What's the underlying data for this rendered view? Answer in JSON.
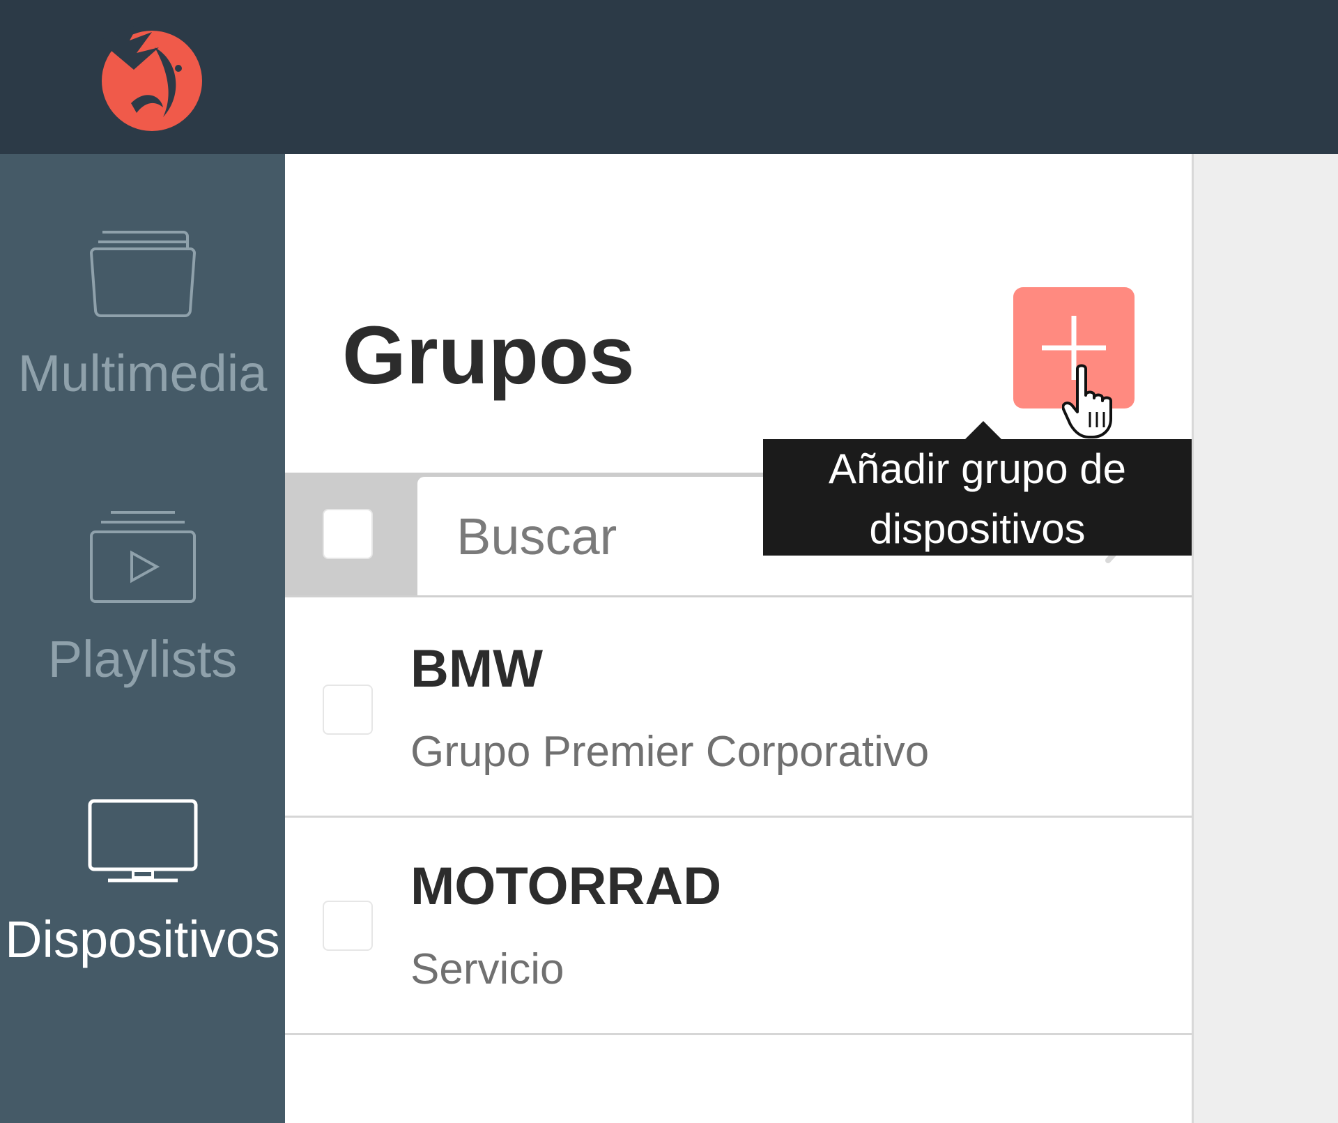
{
  "app": {
    "logo_icon": "fox-logo-icon",
    "brand_color": "#f05a4a"
  },
  "sidebar": {
    "items": [
      {
        "label": "Multimedia",
        "icon": "folder-icon",
        "active": false
      },
      {
        "label": "Playlists",
        "icon": "playlist-icon",
        "active": false
      },
      {
        "label": "Dispositivos",
        "icon": "monitor-icon",
        "active": true
      }
    ]
  },
  "main": {
    "title": "Grupos",
    "add_button": {
      "icon": "plus-icon",
      "color": "#ff8a80"
    },
    "tooltip": "Añadir grupo de dispositivos",
    "search": {
      "placeholder": "Buscar",
      "value": ""
    },
    "groups": [
      {
        "name": "BMW",
        "description": "Grupo Premier Corporativo"
      },
      {
        "name": "MOTORRAD",
        "description": "Servicio"
      }
    ]
  }
}
